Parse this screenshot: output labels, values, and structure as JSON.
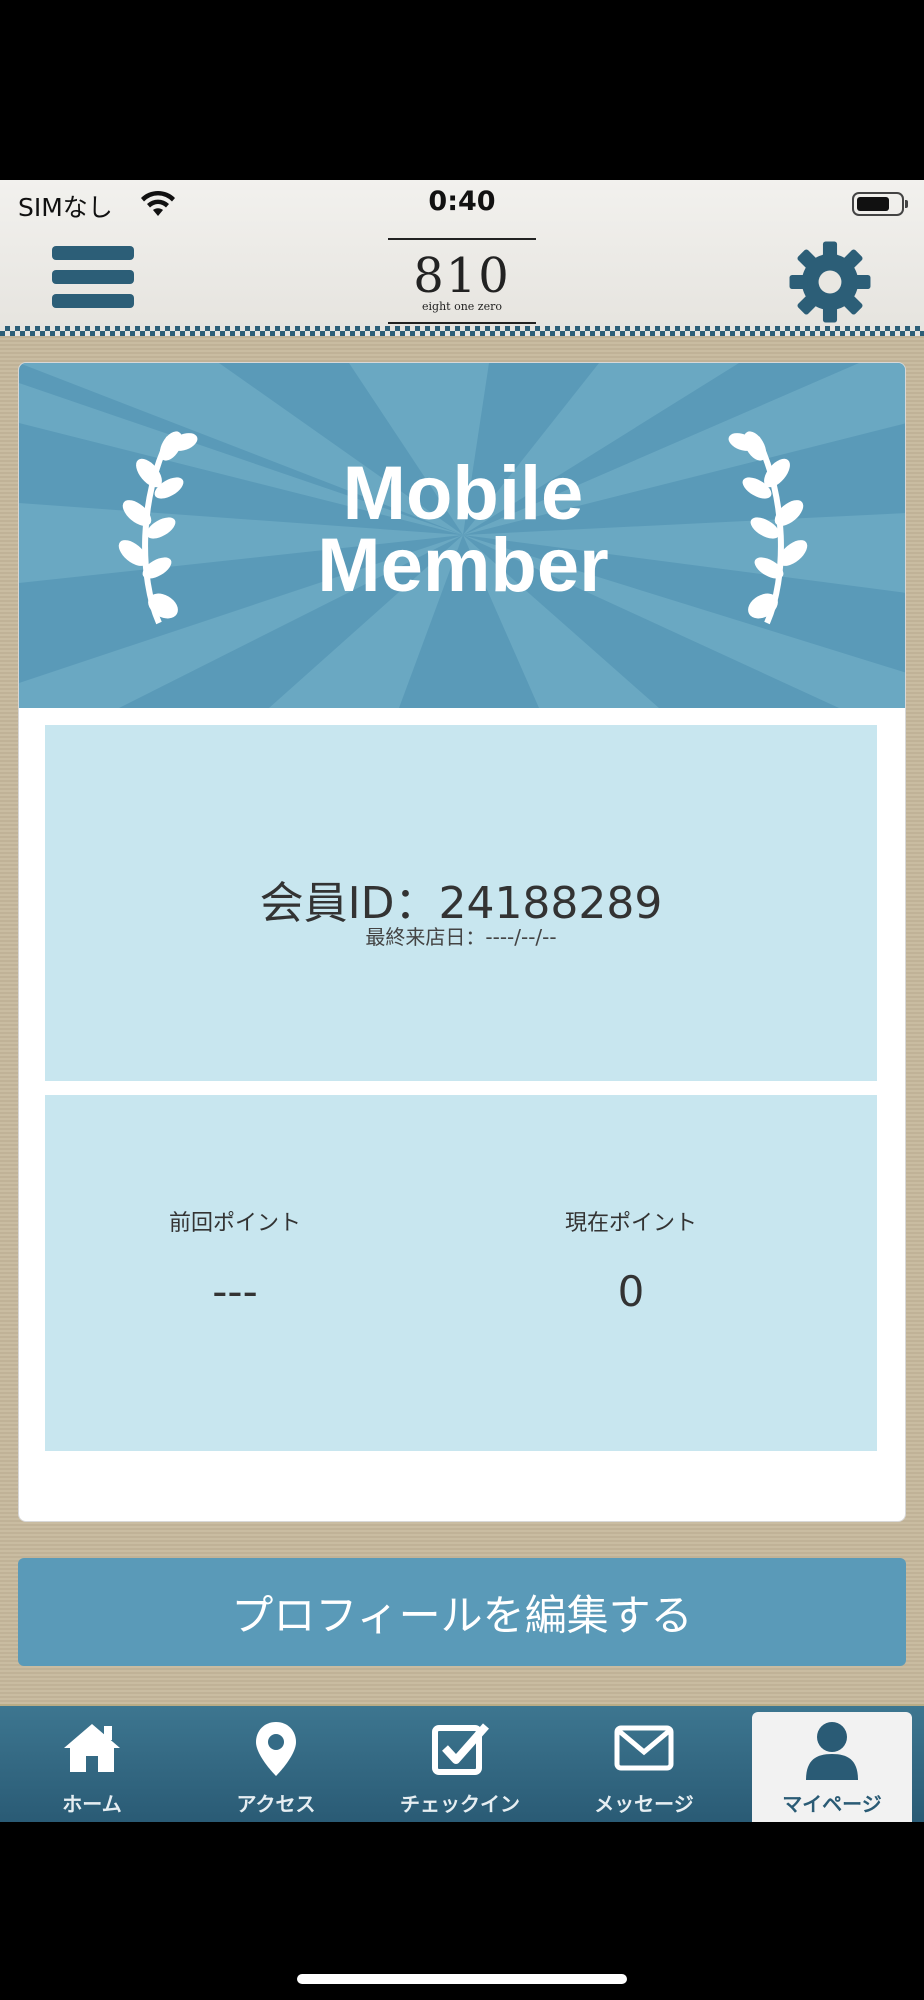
{
  "status_bar": {
    "carrier": "SIMなし",
    "time": "0:40"
  },
  "header": {
    "logo_main": "810",
    "logo_sub": "eight one zero"
  },
  "banner": {
    "title_line1": "Mobile",
    "title_line2": "Member"
  },
  "member": {
    "id_text": "会員ID：24188289",
    "last_visit": "最終来店日：----/--/--"
  },
  "points": {
    "prev_label": "前回ポイント",
    "prev_value": "---",
    "current_label": "現在ポイント",
    "current_value": "0"
  },
  "edit_profile_label": "プロフィールを編集する",
  "tabs": [
    {
      "label": "ホーム",
      "icon": "home-icon"
    },
    {
      "label": "アクセス",
      "icon": "map-pin-icon"
    },
    {
      "label": "チェックイン",
      "icon": "checkbox-icon"
    },
    {
      "label": "メッセージ",
      "icon": "mail-icon"
    },
    {
      "label": "マイページ",
      "icon": "user-icon",
      "active": true
    }
  ],
  "colors": {
    "accent": "#5a9ab8",
    "dark_accent": "#2c5e77",
    "panel": "#c8e6ef",
    "background": "#c6b89c"
  }
}
